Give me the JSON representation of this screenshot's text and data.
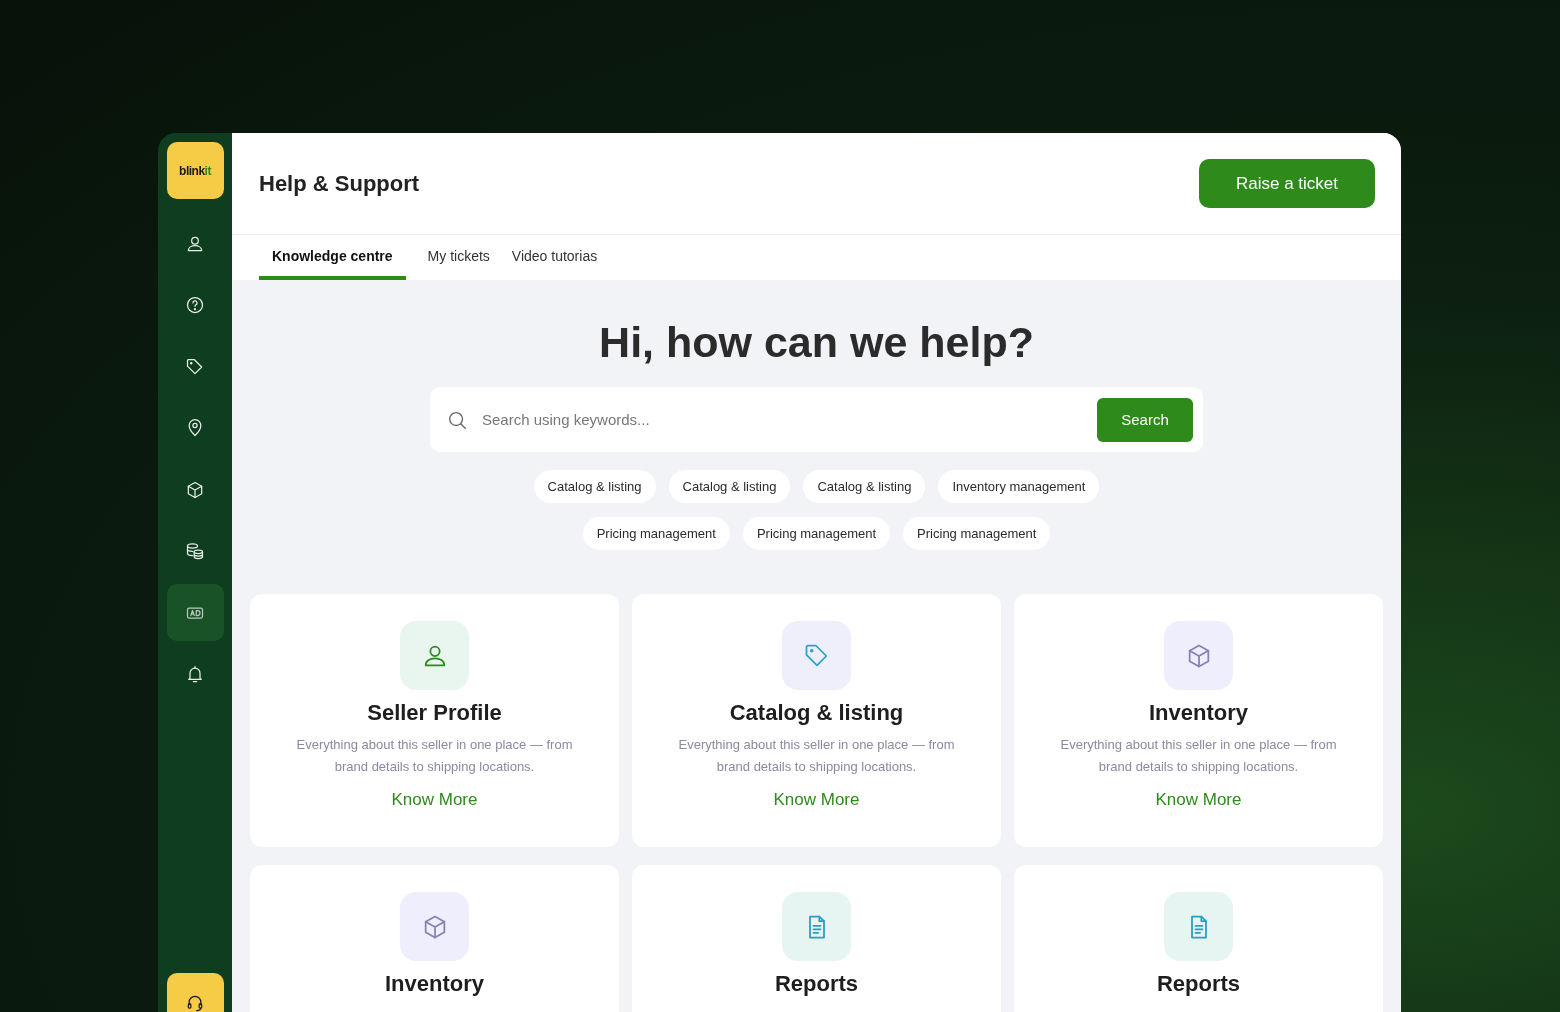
{
  "logo": [
    {
      "text": "blink",
      "accent": false
    },
    {
      "text": "it",
      "accent": true
    }
  ],
  "sidebar": {
    "items": [
      {
        "kind": "user",
        "selected": false
      },
      {
        "kind": "help",
        "selected": false
      },
      {
        "kind": "tag",
        "selected": false
      },
      {
        "kind": "pin",
        "selected": false
      },
      {
        "kind": "box",
        "selected": false
      },
      {
        "kind": "coins",
        "selected": false
      },
      {
        "kind": "ad",
        "selected": true
      },
      {
        "kind": "bell",
        "selected": false
      }
    ],
    "support": {
      "kind": "headset"
    }
  },
  "header": {
    "title": "Help & Support",
    "button": "Raise a ticket"
  },
  "tabs": [
    {
      "label": "Knowledge centre",
      "selected": true
    },
    {
      "label": "My tickets",
      "selected": false
    },
    {
      "label": "Video tutorias",
      "selected": false
    }
  ],
  "hero": {
    "heading": "Hi, how can we help?"
  },
  "search": {
    "placeholder": "Search using keywords...",
    "button": "Search"
  },
  "chip_rows": [
    [
      "Catalog & listing",
      "Catalog & listing",
      "Catalog & listing",
      "Inventory management"
    ],
    [
      "Pricing management",
      "Pricing management",
      "Pricing management"
    ]
  ],
  "cards": [
    {
      "kind": "person",
      "title": "Seller Profile",
      "description": "Everything about this seller in one place — from brand details to shipping locations.",
      "link": "Know More"
    },
    {
      "kind": "tag",
      "title": "Catalog & listing",
      "description": "Everything about this seller in one place — from brand details to shipping locations.",
      "link": "Know More"
    },
    {
      "kind": "box",
      "title": "Inventory",
      "description": "Everything about this seller in one place — from brand details to shipping locations.",
      "link": "Know More"
    },
    {
      "kind": "box",
      "title": "Inventory"
    },
    {
      "kind": "document",
      "title": "Reports"
    },
    {
      "kind": "document",
      "title": "Reports"
    }
  ]
}
